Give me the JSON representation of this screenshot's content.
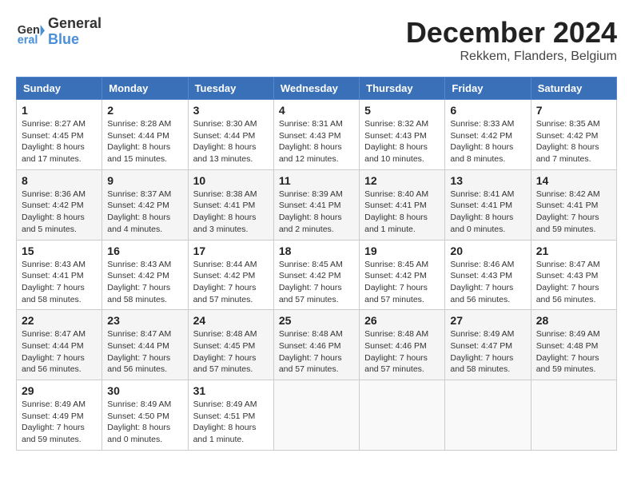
{
  "logo": {
    "line1": "General",
    "line2": "Blue"
  },
  "title": "December 2024",
  "location": "Rekkem, Flanders, Belgium",
  "days_of_week": [
    "Sunday",
    "Monday",
    "Tuesday",
    "Wednesday",
    "Thursday",
    "Friday",
    "Saturday"
  ],
  "weeks": [
    [
      {
        "day": "1",
        "sunrise": "8:27 AM",
        "sunset": "4:45 PM",
        "daylight": "8 hours and 17 minutes."
      },
      {
        "day": "2",
        "sunrise": "8:28 AM",
        "sunset": "4:44 PM",
        "daylight": "8 hours and 15 minutes."
      },
      {
        "day": "3",
        "sunrise": "8:30 AM",
        "sunset": "4:44 PM",
        "daylight": "8 hours and 13 minutes."
      },
      {
        "day": "4",
        "sunrise": "8:31 AM",
        "sunset": "4:43 PM",
        "daylight": "8 hours and 12 minutes."
      },
      {
        "day": "5",
        "sunrise": "8:32 AM",
        "sunset": "4:43 PM",
        "daylight": "8 hours and 10 minutes."
      },
      {
        "day": "6",
        "sunrise": "8:33 AM",
        "sunset": "4:42 PM",
        "daylight": "8 hours and 8 minutes."
      },
      {
        "day": "7",
        "sunrise": "8:35 AM",
        "sunset": "4:42 PM",
        "daylight": "8 hours and 7 minutes."
      }
    ],
    [
      {
        "day": "8",
        "sunrise": "8:36 AM",
        "sunset": "4:42 PM",
        "daylight": "8 hours and 5 minutes."
      },
      {
        "day": "9",
        "sunrise": "8:37 AM",
        "sunset": "4:42 PM",
        "daylight": "8 hours and 4 minutes."
      },
      {
        "day": "10",
        "sunrise": "8:38 AM",
        "sunset": "4:41 PM",
        "daylight": "8 hours and 3 minutes."
      },
      {
        "day": "11",
        "sunrise": "8:39 AM",
        "sunset": "4:41 PM",
        "daylight": "8 hours and 2 minutes."
      },
      {
        "day": "12",
        "sunrise": "8:40 AM",
        "sunset": "4:41 PM",
        "daylight": "8 hours and 1 minute."
      },
      {
        "day": "13",
        "sunrise": "8:41 AM",
        "sunset": "4:41 PM",
        "daylight": "8 hours and 0 minutes."
      },
      {
        "day": "14",
        "sunrise": "8:42 AM",
        "sunset": "4:41 PM",
        "daylight": "7 hours and 59 minutes."
      }
    ],
    [
      {
        "day": "15",
        "sunrise": "8:43 AM",
        "sunset": "4:41 PM",
        "daylight": "7 hours and 58 minutes."
      },
      {
        "day": "16",
        "sunrise": "8:43 AM",
        "sunset": "4:42 PM",
        "daylight": "7 hours and 58 minutes."
      },
      {
        "day": "17",
        "sunrise": "8:44 AM",
        "sunset": "4:42 PM",
        "daylight": "7 hours and 57 minutes."
      },
      {
        "day": "18",
        "sunrise": "8:45 AM",
        "sunset": "4:42 PM",
        "daylight": "7 hours and 57 minutes."
      },
      {
        "day": "19",
        "sunrise": "8:45 AM",
        "sunset": "4:42 PM",
        "daylight": "7 hours and 57 minutes."
      },
      {
        "day": "20",
        "sunrise": "8:46 AM",
        "sunset": "4:43 PM",
        "daylight": "7 hours and 56 minutes."
      },
      {
        "day": "21",
        "sunrise": "8:47 AM",
        "sunset": "4:43 PM",
        "daylight": "7 hours and 56 minutes."
      }
    ],
    [
      {
        "day": "22",
        "sunrise": "8:47 AM",
        "sunset": "4:44 PM",
        "daylight": "7 hours and 56 minutes."
      },
      {
        "day": "23",
        "sunrise": "8:47 AM",
        "sunset": "4:44 PM",
        "daylight": "7 hours and 56 minutes."
      },
      {
        "day": "24",
        "sunrise": "8:48 AM",
        "sunset": "4:45 PM",
        "daylight": "7 hours and 57 minutes."
      },
      {
        "day": "25",
        "sunrise": "8:48 AM",
        "sunset": "4:46 PM",
        "daylight": "7 hours and 57 minutes."
      },
      {
        "day": "26",
        "sunrise": "8:48 AM",
        "sunset": "4:46 PM",
        "daylight": "7 hours and 57 minutes."
      },
      {
        "day": "27",
        "sunrise": "8:49 AM",
        "sunset": "4:47 PM",
        "daylight": "7 hours and 58 minutes."
      },
      {
        "day": "28",
        "sunrise": "8:49 AM",
        "sunset": "4:48 PM",
        "daylight": "7 hours and 59 minutes."
      }
    ],
    [
      {
        "day": "29",
        "sunrise": "8:49 AM",
        "sunset": "4:49 PM",
        "daylight": "7 hours and 59 minutes."
      },
      {
        "day": "30",
        "sunrise": "8:49 AM",
        "sunset": "4:50 PM",
        "daylight": "8 hours and 0 minutes."
      },
      {
        "day": "31",
        "sunrise": "8:49 AM",
        "sunset": "4:51 PM",
        "daylight": "8 hours and 1 minute."
      },
      null,
      null,
      null,
      null
    ]
  ],
  "labels": {
    "sunrise": "Sunrise: ",
    "sunset": "Sunset: ",
    "daylight": "Daylight: "
  }
}
